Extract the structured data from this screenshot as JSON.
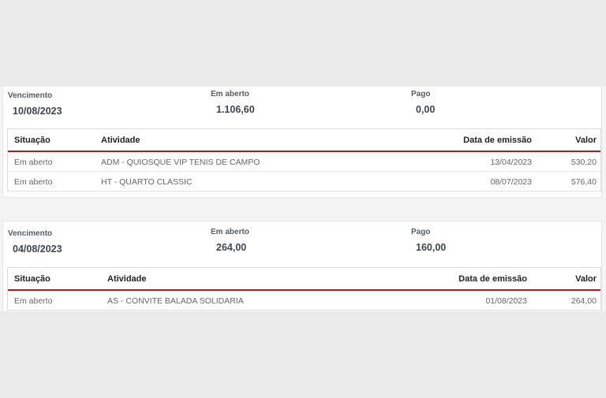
{
  "groups": [
    {
      "labels": {
        "due": "Vencimento",
        "open": "Em aberto",
        "paid": "Pago"
      },
      "due_date": "10/08/2023",
      "open_amount": "1.106,60",
      "paid_amount": "0,00",
      "columns": {
        "status": "Situação",
        "activity": "Atividade",
        "issue_date": "Data de emissão",
        "value": "Valor"
      },
      "rows": [
        {
          "status": "Em aberto",
          "activity": "ADM - QUIOSQUE VIP TENIS DE CAMPO",
          "issue_date": "13/04/2023",
          "value": "530,20"
        },
        {
          "status": "Em aberto",
          "activity": "HT - QUARTO CLASSIC",
          "issue_date": "08/07/2023",
          "value": "576,40"
        }
      ]
    },
    {
      "labels": {
        "due": "Vencimento",
        "open": "Em aberto",
        "paid": "Pago"
      },
      "due_date": "04/08/2023",
      "open_amount": "264,00",
      "paid_amount": "160,00",
      "columns": {
        "status": "Situação",
        "activity": "Atividade",
        "issue_date": "Data de emissão",
        "value": "Valor"
      },
      "rows": [
        {
          "status": "Em aberto",
          "activity": "AS - CONVITE BALADA SOLIDARIA",
          "issue_date": "01/08/2023",
          "value": "264,00"
        }
      ]
    }
  ]
}
